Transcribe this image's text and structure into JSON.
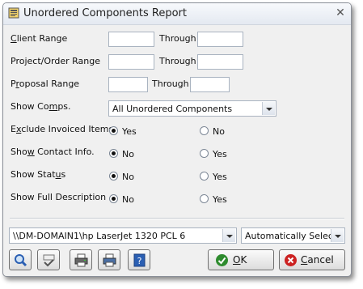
{
  "window": {
    "title": "Unordered Components Report",
    "close_glyph": "✕"
  },
  "form": {
    "client_range": {
      "label_u": "C",
      "label_rest": "lient Range",
      "from": "",
      "through_label": "Through",
      "to": ""
    },
    "project_range": {
      "label_pre": "Pro",
      "label_u": "j",
      "label_rest": "ect/Order Range",
      "from": "",
      "through_label": "Through",
      "to": ""
    },
    "proposal_range": {
      "label_pre": "P",
      "label_u": "r",
      "label_rest": "oposal Range",
      "from": "",
      "through_label": "Through",
      "to": ""
    },
    "show_comps": {
      "label_pre": "Show Co",
      "label_u": "m",
      "label_rest": "ps.",
      "value": "All Unordered Components"
    },
    "exclude_invoiced": {
      "label_pre": "E",
      "label_u": "x",
      "label_rest": "clude Invoiced Items",
      "yes": "Yes",
      "no": "No",
      "selected": "Yes"
    },
    "show_contact": {
      "label_pre": "Sho",
      "label_u": "w",
      "label_rest": " Contact Info.",
      "no": "No",
      "yes": "Yes",
      "selected": "No"
    },
    "show_status": {
      "label_pre": "Show Stat",
      "label_u": "u",
      "label_rest": "s",
      "no": "No",
      "yes": "Yes",
      "selected": "No"
    },
    "show_full_desc": {
      "label_pre": "Show Full Description",
      "label_u": "",
      "label_rest": "",
      "no": "No",
      "yes": "Yes",
      "selected": "No"
    }
  },
  "printer": {
    "name": "\\\\DM-DOMAIN1\\hp LaserJet 1320 PCL 6",
    "tray": "Automatically Select"
  },
  "toolbar": {
    "preview_icon": "magnifier-icon",
    "spellcheck_icon": "abc-check-icon",
    "print_icon": "printer-icon",
    "print_setup_icon": "printer-setup-icon",
    "help_icon": "help-icon"
  },
  "buttons": {
    "ok_pre": "",
    "ok_u": "O",
    "ok_rest": "K",
    "cancel_pre": "",
    "cancel_u": "C",
    "cancel_rest": "ancel"
  },
  "colors": {
    "ok_check": "#2e8b2e",
    "cancel_x": "#cc2222",
    "help_blue": "#2b5fb3"
  }
}
